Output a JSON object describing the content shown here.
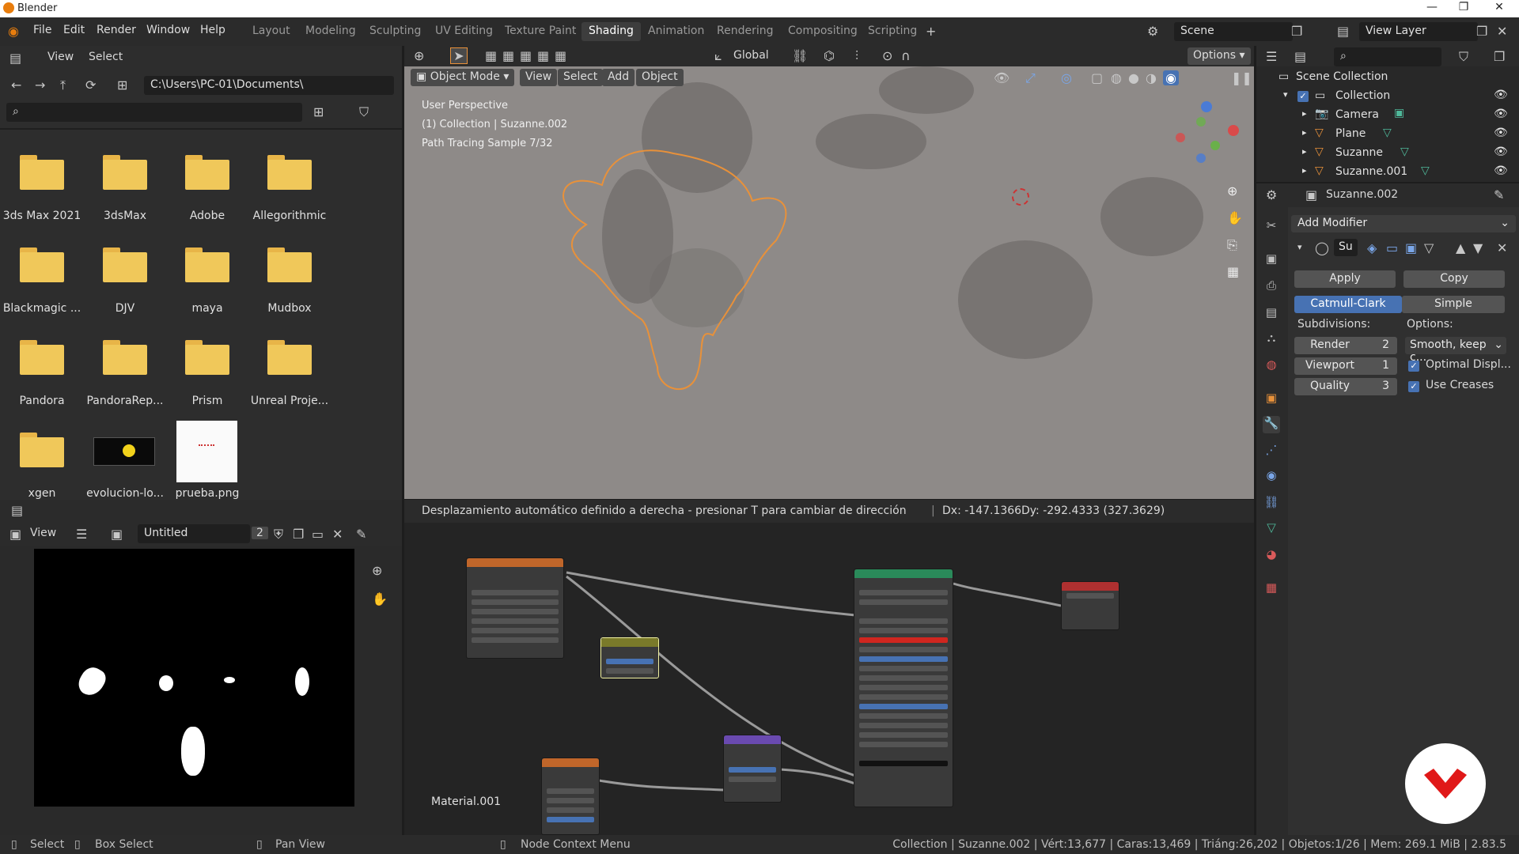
{
  "window": {
    "title": "Blender"
  },
  "menu": {
    "file": "File",
    "edit": "Edit",
    "render": "Render",
    "window": "Window",
    "help": "Help"
  },
  "workspaces": [
    "Layout",
    "Modeling",
    "Sculpting",
    "UV Editing",
    "Texture Paint",
    "Shading",
    "Animation",
    "Rendering",
    "Compositing",
    "Scripting"
  ],
  "active_workspace": "Shading",
  "scene": {
    "label": "Scene"
  },
  "view_layer": {
    "label": "View Layer"
  },
  "filebrowser": {
    "view": "View",
    "select": "Select",
    "path": "C:\\Users\\PC-01\\Documents\\",
    "items": [
      "3ds Max 2021",
      "3dsMax",
      "Adobe",
      "Allegorithmic",
      "Blackmagic ...",
      "DJV",
      "maya",
      "Mudbox",
      "Pandora",
      "PandoraRep...",
      "Prism",
      "Unreal Proje...",
      "xgen",
      "evolucion-lo...",
      "prueba.png"
    ]
  },
  "imageeditor": {
    "view": "View",
    "image_name": "Untitled",
    "users": "2"
  },
  "viewport": {
    "mode": "Object Mode",
    "view": "View",
    "select": "Select",
    "add": "Add",
    "object": "Object",
    "orientation": "Global",
    "options": "Options",
    "overlay_line1": "User Perspective",
    "overlay_line2": "(1) Collection | Suzanne.002",
    "overlay_line3": "Path Tracing Sample 7/32"
  },
  "header_status": {
    "message": "Desplazamiento automático definido a derecha - presionar T para cambiar de dirección",
    "dx": "Dx: -147.1366",
    "dy": "Dy: -292.4333 (327.3629)"
  },
  "nodeeditor": {
    "material": "Material.001"
  },
  "outliner": {
    "scene_collection": "Scene Collection",
    "collection": "Collection",
    "items": [
      "Camera",
      "Plane",
      "Suzanne",
      "Suzanne.001"
    ]
  },
  "properties": {
    "object": "Suzanne.002",
    "add_modifier": "Add Modifier",
    "modifier_name": "Su",
    "apply": "Apply",
    "copy": "Copy",
    "catmull": "Catmull-Clark",
    "simple": "Simple",
    "subdivisions": "Subdivisions:",
    "options": "Options:",
    "render_label": "Render",
    "render_value": "2",
    "viewport_label": "Viewport",
    "viewport_value": "1",
    "quality_label": "Quality",
    "quality_value": "3",
    "uv_smooth": "Smooth, keep c...",
    "optimal_display": "Optimal Displ...",
    "use_creases": "Use Creases"
  },
  "statusbar": {
    "select": "Select",
    "box_select": "Box Select",
    "pan_view": "Pan View",
    "node_context": "Node Context Menu",
    "info": "Collection | Suzanne.002 | Vért:13,677 | Caras:13,469 | Triáng:26,202 | Objetos:1/26 | Mem: 269.1 MiB | 2.83.5"
  },
  "colors": {
    "accent": "#4772b3",
    "active_tab": "#3d3d3d",
    "selection_outline": "#e8913a"
  }
}
